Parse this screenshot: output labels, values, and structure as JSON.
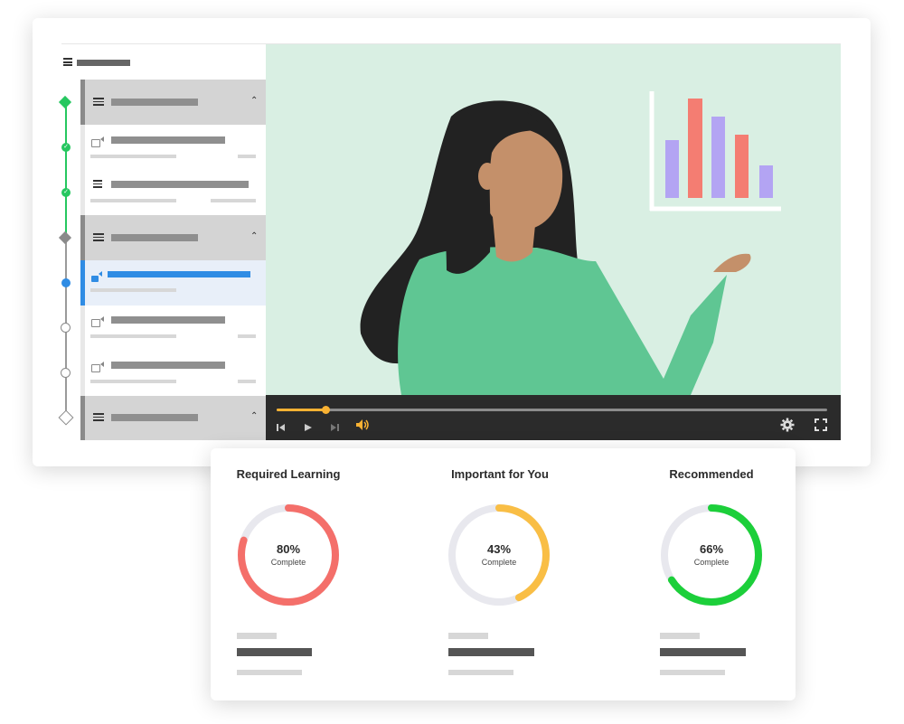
{
  "player": {
    "progress_fraction": 0.08
  },
  "sidebar": {
    "sections": [
      {
        "state": "complete"
      },
      {
        "state": "in-progress"
      },
      {
        "state": "locked"
      }
    ]
  },
  "cards": [
    {
      "title": "Required Learning",
      "percent_label": "80%",
      "percent": 80,
      "status": "Complete",
      "color": "#f46f6a"
    },
    {
      "title": "Important for You",
      "percent_label": "43%",
      "percent": 43,
      "status": "Complete",
      "color": "#f9be45"
    },
    {
      "title": "Recommended",
      "percent_label": "66%",
      "percent": 66,
      "status": "Complete",
      "color": "#1ccf3a"
    }
  ],
  "colors": {
    "accent_blue": "#2f8ce4",
    "complete_green": "#26c760",
    "video_bg": "#d9efe3",
    "controls_bg": "#2b2b2b",
    "scrub_accent": "#f9b233"
  }
}
